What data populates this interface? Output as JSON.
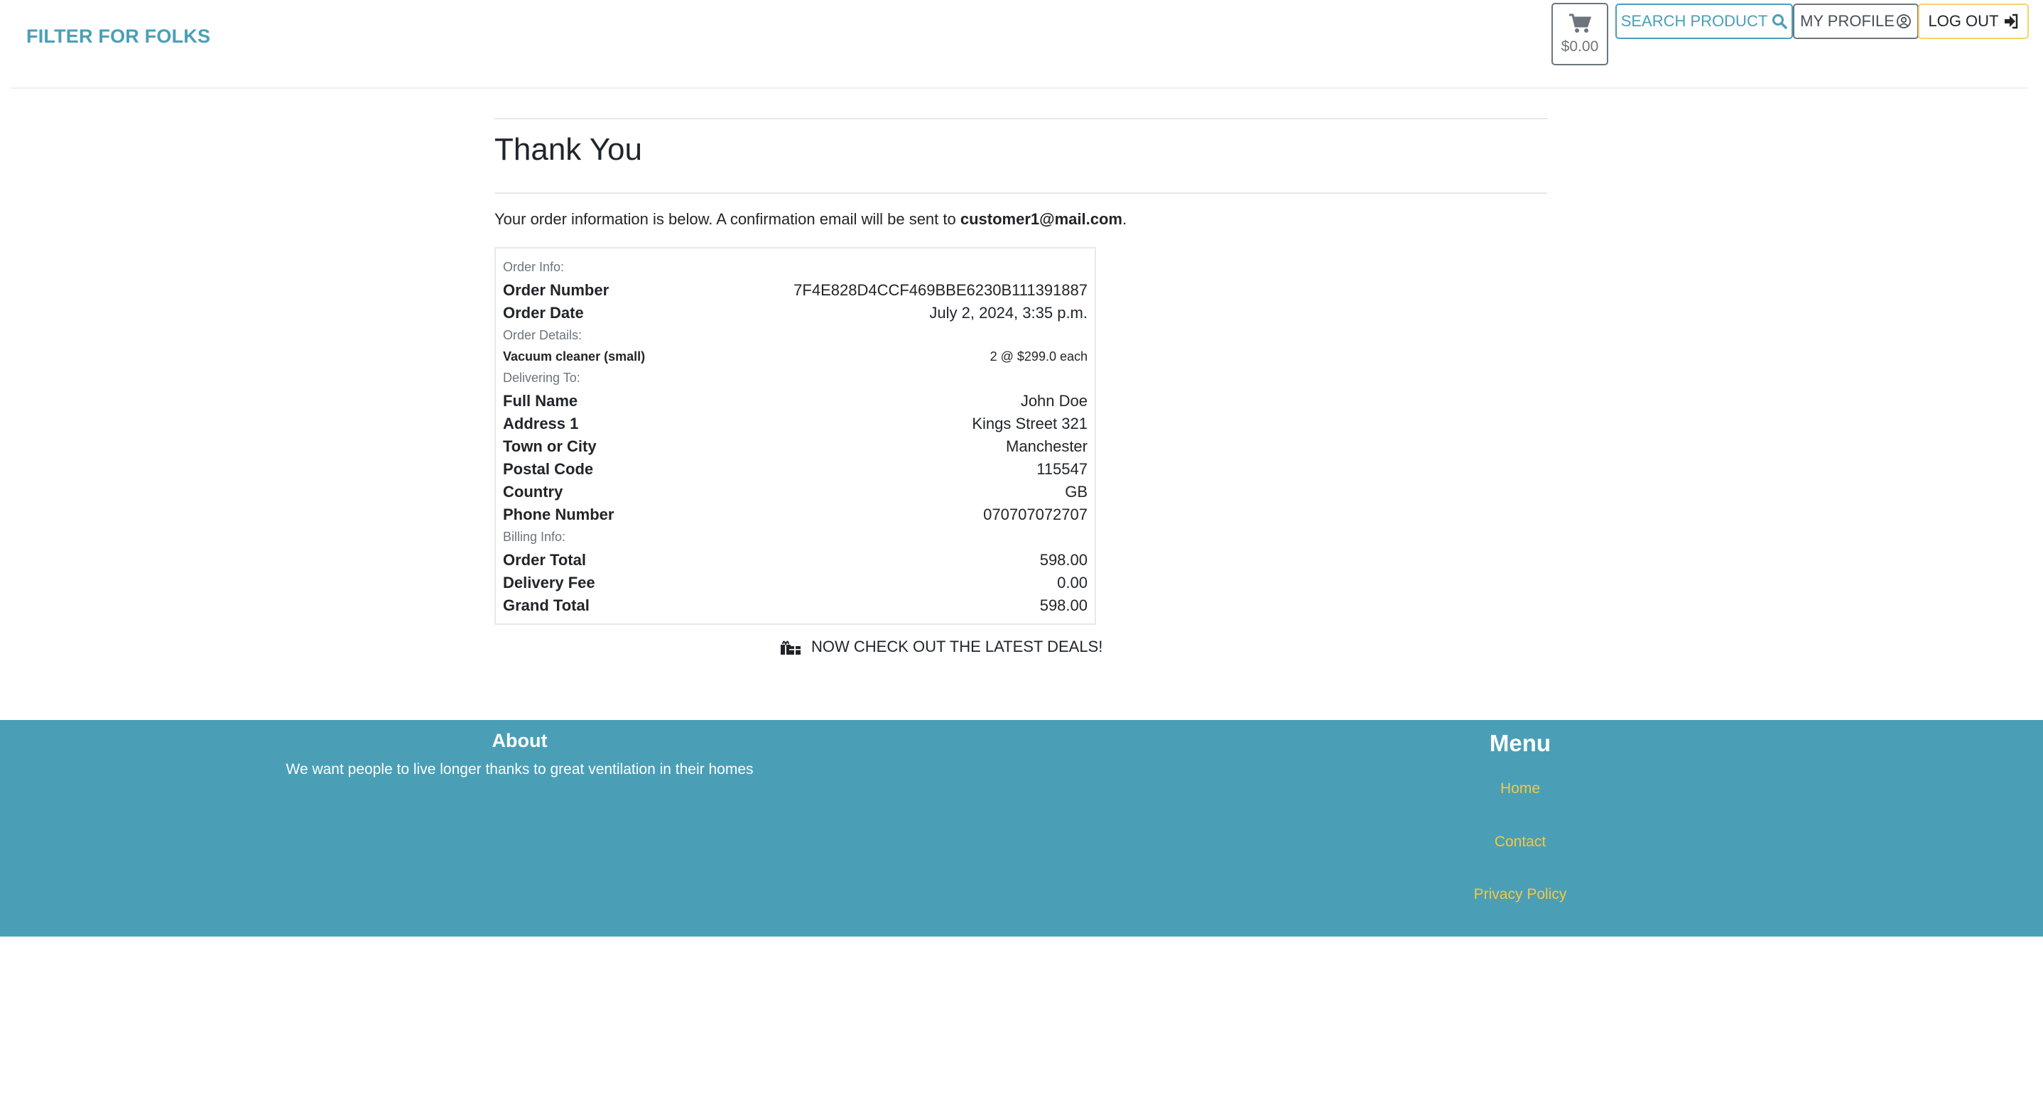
{
  "header": {
    "brand": "FILTER FOR FOLKS",
    "cart_icon": "shopping-cart-icon",
    "cart_total": "$0.00",
    "search_label": "SEARCH PRODUCT",
    "profile_label": "MY PROFILE",
    "logout_label": "LOG OUT",
    "accent_color": "#4a9fb6"
  },
  "main": {
    "title": "Thank You",
    "intro_text": "Your order information is below. A confirmation email will be sent to",
    "email": "customer1@mail.com",
    "intro_end": ".",
    "order_info": {
      "section_label": "Order Info:",
      "order_number_label": "Order Number",
      "order_number": "7F4E828D4CCF469BBE6230B111391887",
      "order_date_label": "Order Date",
      "order_date": "July 2, 2024, 3:35 p.m."
    },
    "order_details": {
      "section_label": "Order Details:",
      "items": [
        {
          "name": "Vacuum cleaner (small)",
          "qty_price": "2 @ $299.0 each"
        }
      ]
    },
    "delivering_to": {
      "section_label": "Delivering To:",
      "full_name_label": "Full Name",
      "full_name": "John Doe",
      "address1_label": "Address 1",
      "address1": "Kings Street 321",
      "town_label": "Town or City",
      "town": "Manchester",
      "postal_label": "Postal Code",
      "postal": "115547",
      "country_label": "Country",
      "country": "GB",
      "phone_label": "Phone Number",
      "phone": "070707072707"
    },
    "billing_info": {
      "section_label": "Billing Info:",
      "order_total_label": "Order Total",
      "order_total": "598.00",
      "delivery_fee_label": "Delivery Fee",
      "delivery_fee": "0.00",
      "grand_total_label": "Grand Total",
      "grand_total": "598.00"
    },
    "deals_label": "NOW CHECK OUT THE LATEST DEALS!"
  },
  "footer": {
    "about_title": "About",
    "about_text": "We want people to live longer thanks to great ventilation in their homes",
    "menu_title": "Menu",
    "menu_items": [
      "Home",
      "Contact",
      "Privacy Policy"
    ],
    "link_color": "#f5c842"
  }
}
